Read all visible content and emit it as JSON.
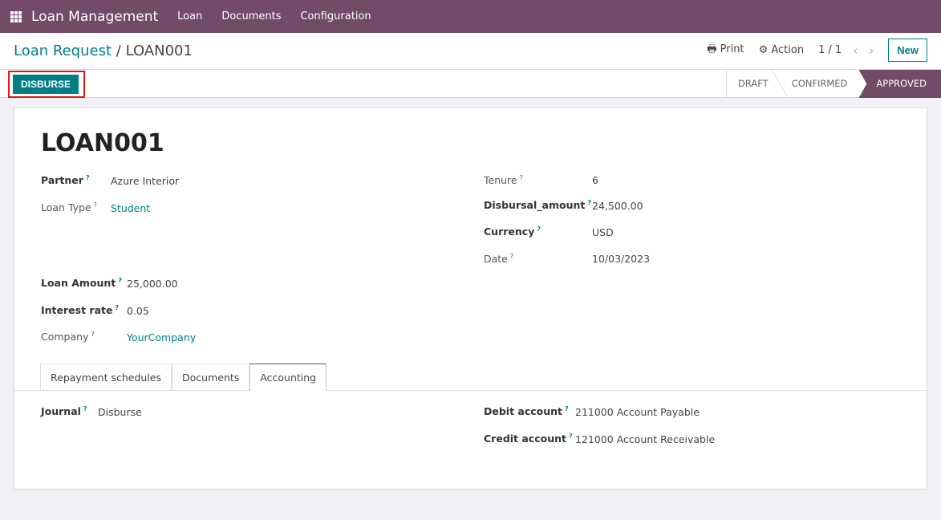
{
  "nav": {
    "app_title": "Loan Management",
    "menus": [
      "Loan",
      "Documents",
      "Configuration"
    ]
  },
  "control": {
    "breadcrumb_parent": "Loan Request",
    "breadcrumb_sep": "/",
    "breadcrumb_current": "LOAN001",
    "print": "Print",
    "action": "Action",
    "pager": "1 / 1",
    "new": "New",
    "disburse": "DISBURSE"
  },
  "statusbar": [
    "DRAFT",
    "CONFIRMED",
    "APPROVED"
  ],
  "record": {
    "title": "LOAN001",
    "left": [
      {
        "label": "Partner",
        "value": "Azure Interior"
      },
      {
        "label": "Loan Type",
        "value": "Student"
      },
      {
        "label": "Loan Amount",
        "value": "25,000.00"
      },
      {
        "label": "Interest rate",
        "value": "0.05"
      },
      {
        "label": "Company",
        "value": "YourCompany"
      }
    ],
    "right": [
      {
        "label": "Tenure",
        "value": "6"
      },
      {
        "label": "Disbursal_amount",
        "value": "24,500.00"
      },
      {
        "label": "Currency",
        "value": "USD"
      },
      {
        "label": "Date",
        "value": "10/03/2023"
      }
    ],
    "help": "?"
  },
  "tabs": [
    "Repayment schedules",
    "Documents",
    "Accounting"
  ],
  "accounting": {
    "journal_label": "Journal",
    "journal": "Disburse",
    "debit_label": "Debit account",
    "debit": "211000 Account Payable",
    "credit_label": "Credit account",
    "credit": "121000 Account Receivable"
  },
  "colors": {
    "brand": "#714b67",
    "accent": "#017e84"
  }
}
